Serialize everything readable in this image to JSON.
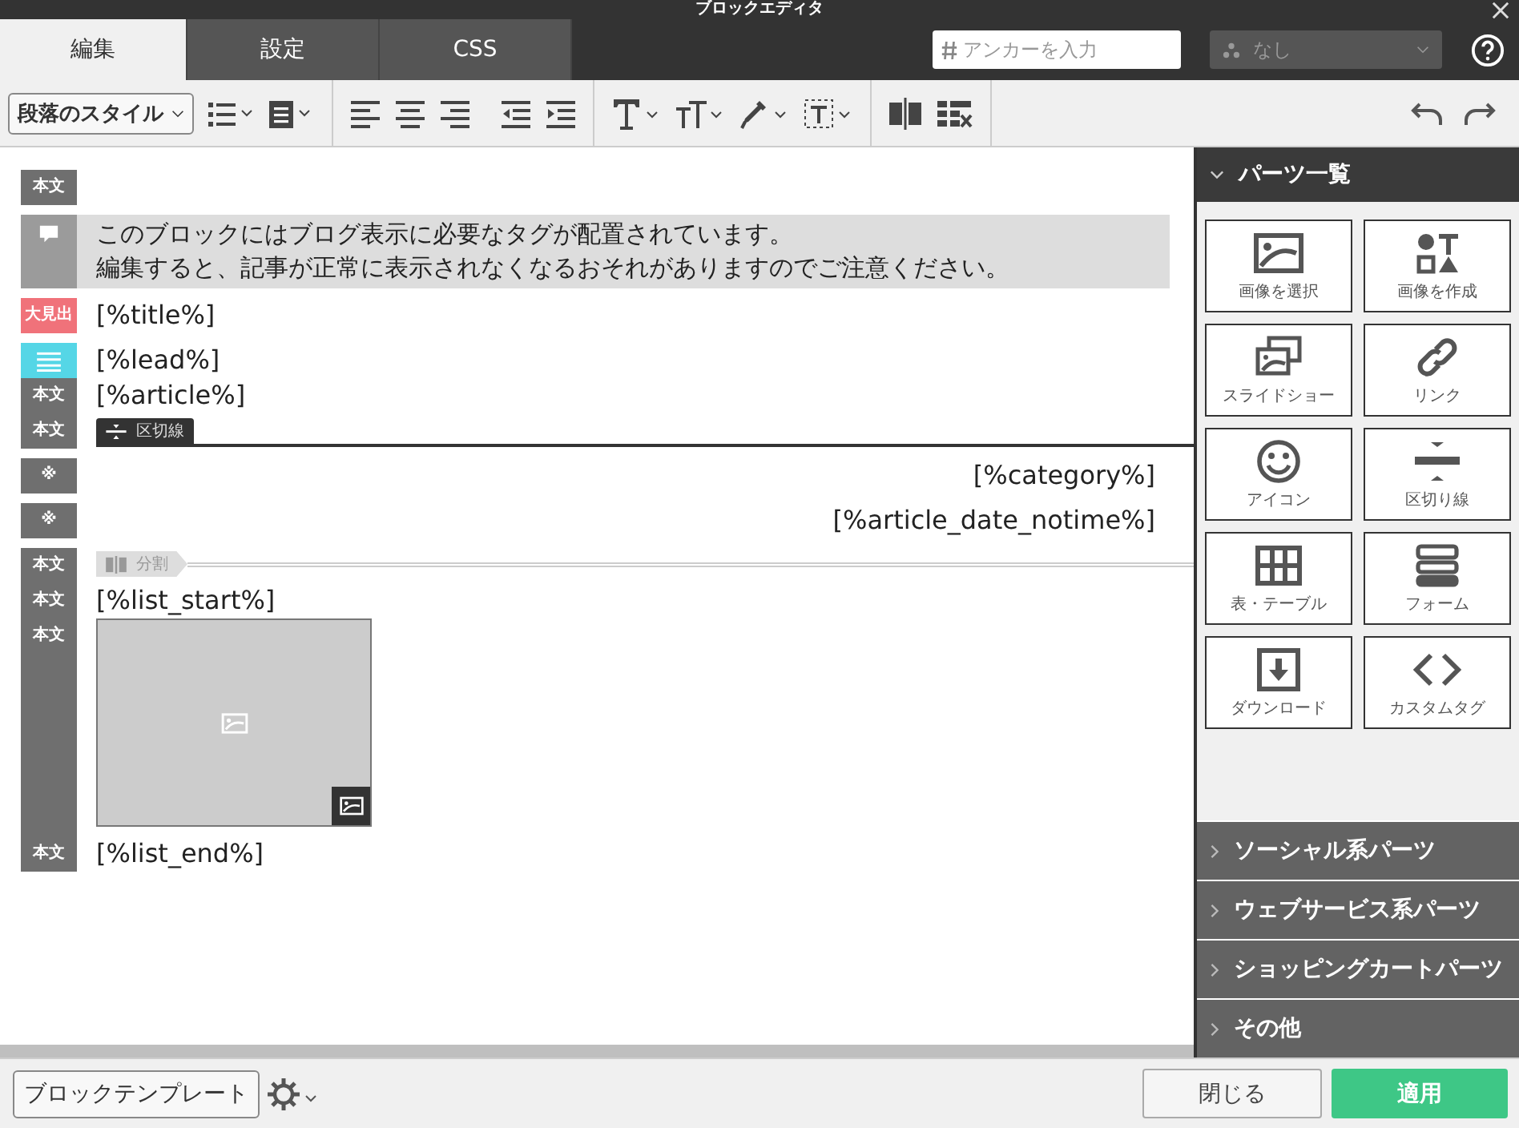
{
  "window": {
    "title": "ブロックエディタ"
  },
  "tabs": [
    {
      "label": "編集",
      "selected": true
    },
    {
      "label": "設定",
      "selected": false
    },
    {
      "label": "CSS",
      "selected": false
    }
  ],
  "anchor": {
    "placeholder": "アンカーを入力"
  },
  "target_select": {
    "value": "なし",
    "disabled": true
  },
  "toolbar": {
    "paragraph_style": "段落のスタイル"
  },
  "editor": {
    "groups": [
      [
        {
          "kind": "text",
          "label": {
            "kind": "text",
            "text": "本文",
            "color": "#6f6f6f"
          }
        }
      ],
      [
        {
          "kind": "notice",
          "label": {
            "kind": "comment",
            "color": "#9b9b9b"
          },
          "lines": [
            "このブロックにはブログ表示に必要なタグが配置されています。",
            "編集すると、記事が正常に表示されなくなるおそれがありますのでご注意ください。"
          ]
        }
      ],
      [
        {
          "kind": "text",
          "label": {
            "kind": "text",
            "text": "大見出",
            "color": "#f0727a"
          },
          "text": "[%title%]"
        }
      ],
      [
        {
          "kind": "text",
          "label": {
            "kind": "lines",
            "color": "#55d6e6"
          },
          "text": "[%lead%]"
        },
        {
          "kind": "text",
          "label": {
            "kind": "text",
            "text": "本文",
            "color": "#6f6f6f"
          },
          "text": "[%article%]"
        },
        {
          "kind": "divider",
          "label": {
            "kind": "text",
            "text": "本文",
            "color": "#6f6f6f"
          },
          "text": "区切線"
        }
      ],
      [
        {
          "kind": "right_text",
          "label": {
            "kind": "text",
            "text": "※",
            "color": "#6f6f6f"
          },
          "text": "[%category%]"
        }
      ],
      [
        {
          "kind": "right_text",
          "label": {
            "kind": "text",
            "text": "※",
            "color": "#6f6f6f"
          },
          "text": "[%article_date_notime%]"
        }
      ],
      [
        {
          "kind": "split",
          "label": {
            "kind": "text",
            "text": "本文",
            "color": "#6f6f6f"
          },
          "text": "分割"
        },
        {
          "kind": "text",
          "label": {
            "kind": "text",
            "text": "本文",
            "color": "#6f6f6f"
          },
          "text": "[%list_start%]"
        },
        {
          "kind": "image",
          "label": {
            "kind": "text",
            "text": "本文",
            "color": "#6f6f6f"
          }
        },
        {
          "kind": "text",
          "label": {
            "kind": "text",
            "text": "本文",
            "color": "#6f6f6f"
          },
          "text": "[%list_end%]"
        }
      ]
    ]
  },
  "sidebar": {
    "sections": [
      {
        "title": "パーツ一覧",
        "expanded": true,
        "tiles": [
          "画像を選択",
          "画像を作成",
          "スライドショー",
          "リンク",
          "アイコン",
          "区切り線",
          "表・テーブル",
          "フォーム",
          "ダウンロード",
          "カスタムタグ"
        ]
      },
      {
        "title": "ソーシャル系パーツ",
        "expanded": false
      },
      {
        "title": "ウェブサービス系パーツ",
        "expanded": false
      },
      {
        "title": "ショッピングカートパーツ",
        "expanded": false
      },
      {
        "title": "その他",
        "expanded": false
      }
    ]
  },
  "footer": {
    "template_button": "ブロックテンプレート",
    "close_button": "閉じる",
    "apply_button": "適用"
  }
}
